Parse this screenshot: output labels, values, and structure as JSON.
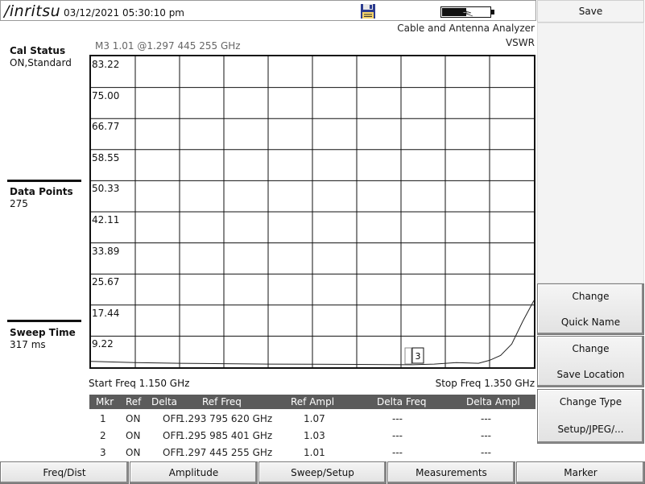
{
  "header": {
    "brand": "/inritsu",
    "datetime": "03/12/2021 05:30:10 pm"
  },
  "left_panel": {
    "cal_status_label": "Cal Status",
    "cal_status_value": "ON,Standard",
    "data_points_label": "Data Points",
    "data_points_value": "275",
    "sweep_time_label": "Sweep Time",
    "sweep_time_value": "317 ms"
  },
  "plot": {
    "marker_readout": "M3 1.01 @1.297 445 255 GHz",
    "mode_title": "Cable and Antenna Analyzer",
    "measurement": "VSWR",
    "start_freq": "Start Freq 1.150 GHz",
    "stop_freq": "Stop Freq 1.350 GHz",
    "marker_label": "3"
  },
  "chart_data": {
    "type": "line",
    "ylabel": "VSWR",
    "y_ticks": [
      "83.22",
      "75.00",
      "66.77",
      "58.55",
      "50.33",
      "42.11",
      "33.89",
      "25.67",
      "17.44",
      "9.22"
    ],
    "ylim": [
      1.0,
      83.22
    ],
    "xlim": [
      1.15,
      1.35
    ],
    "grid": true,
    "series": [
      {
        "x": [
          1.15,
          1.17,
          1.19,
          1.21,
          1.23,
          1.25,
          1.27,
          1.285,
          1.295,
          1.305,
          1.315,
          1.325,
          1.33,
          1.335,
          1.34,
          1.345,
          1.35
        ],
        "y": [
          1.9,
          1.6,
          1.4,
          1.3,
          1.2,
          1.15,
          1.1,
          1.05,
          1.02,
          1.2,
          1.6,
          1.4,
          2.2,
          3.5,
          6.5,
          12.5,
          18.0
        ]
      }
    ]
  },
  "marker_table": {
    "headers": [
      "Mkr",
      "Ref",
      "Delta",
      "Ref Freq",
      "Ref Ampl",
      "Delta Freq",
      "Delta Ampl"
    ],
    "rows": [
      {
        "mkr": "1",
        "ref": "ON",
        "delta": "OFF",
        "ref_freq": "1.293 795 620 GHz",
        "ref_ampl": "1.07",
        "delta_freq": "---",
        "delta_ampl": "---"
      },
      {
        "mkr": "2",
        "ref": "ON",
        "delta": "OFF",
        "ref_freq": "1.295 985 401 GHz",
        "ref_ampl": "1.03",
        "delta_freq": "---",
        "delta_ampl": "---"
      },
      {
        "mkr": "3",
        "ref": "ON",
        "delta": "OFF",
        "ref_freq": "1.297 445 255 GHz",
        "ref_ampl": "1.01",
        "delta_freq": "---",
        "delta_ampl": "---"
      }
    ]
  },
  "softkeys": {
    "save": "Save",
    "change_quick_name_1": "Change",
    "change_quick_name_2": "Quick Name",
    "change_save_location_1": "Change",
    "change_save_location_2": "Save Location",
    "change_type_1": "Change Type",
    "change_type_2": "Setup/JPEG/..."
  },
  "bottom_menu": [
    "Freq/Dist",
    "Amplitude",
    "Sweep/Setup",
    "Measurements",
    "Marker"
  ],
  "colors": {
    "table_header_bg": "#5b5b5b",
    "trace": "#222222",
    "grid": "#111111"
  }
}
